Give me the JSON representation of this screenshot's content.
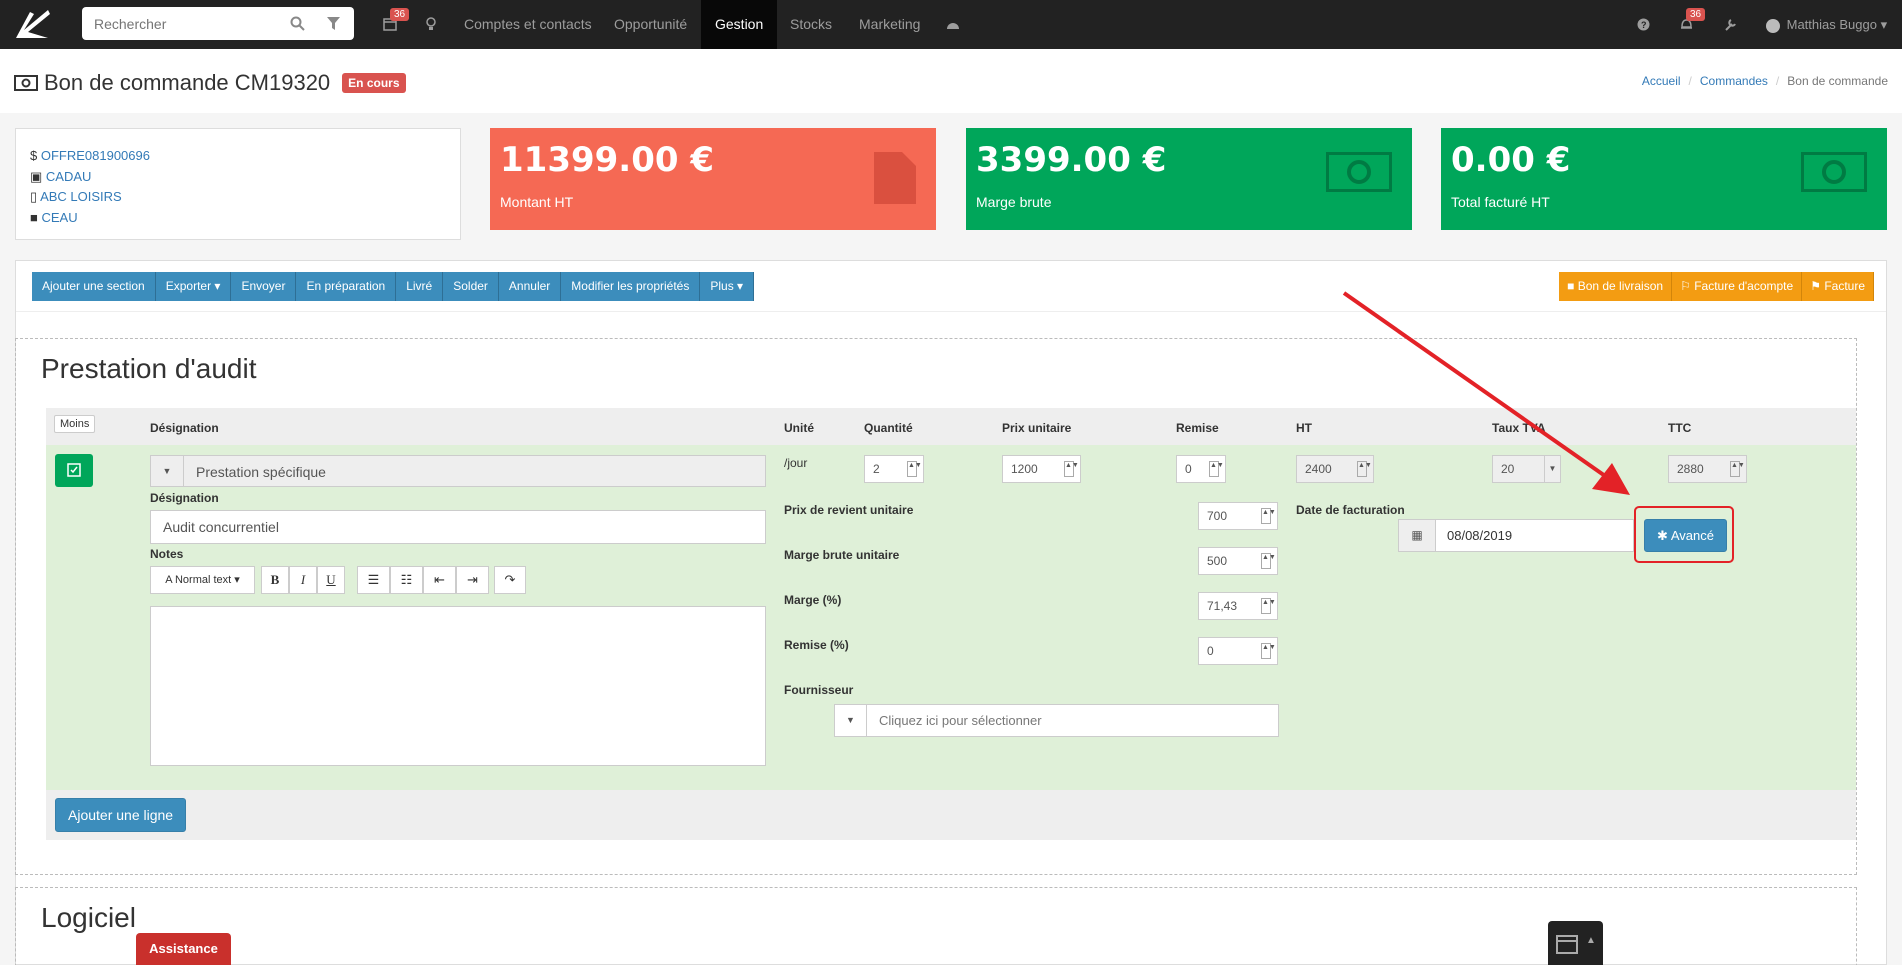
{
  "nav": {
    "search_placeholder": "Rechercher",
    "calendar_badge": "36",
    "notif_badge": "36",
    "links": [
      "Comptes et contacts",
      "Opportunité",
      "Gestion",
      "Stocks",
      "Marketing"
    ],
    "user": "Matthias Buggo"
  },
  "header": {
    "title": "Bon de commande CM19320",
    "status": "En cours",
    "breadcrumb": [
      "Accueil",
      "Commandes",
      "Bon de commande"
    ]
  },
  "info": {
    "offer": "OFFRE081900696",
    "contact": "CADAU",
    "company": "ABC LOISIRS",
    "project": "CEAU"
  },
  "stats": [
    {
      "value": "11399.00 €",
      "label": "Montant HT",
      "color": "#f56954"
    },
    {
      "value": "3399.00 €",
      "label": "Marge brute",
      "color": "#00a65a"
    },
    {
      "value": "0.00 €",
      "label": "Total facturé HT",
      "color": "#00a65a"
    }
  ],
  "toolbar": {
    "left": [
      "Ajouter une section",
      "Exporter",
      "Envoyer",
      "En préparation",
      "Livré",
      "Solder",
      "Annuler",
      "Modifier les propriétés",
      "Plus"
    ],
    "right": [
      "Bon de livraison",
      "Facture d'acompte",
      "Facture"
    ]
  },
  "section1": {
    "title": "Prestation d'audit",
    "less_button": "Moins",
    "columns": [
      "Désignation",
      "Unité",
      "Quantité",
      "Prix unitaire",
      "Remise",
      "HT",
      "Taux TVA",
      "TTC"
    ],
    "row": {
      "product": "Prestation spécifique",
      "unit": "/jour",
      "quantity": "2",
      "unit_price": "1200",
      "discount": "0",
      "ht": "2400",
      "vat": "20",
      "ttc": "2880",
      "designation_label": "Désignation",
      "designation": "Audit concurrentiel",
      "notes_label": "Notes",
      "text_style": "Normal text",
      "cost_label": "Prix de revient unitaire",
      "cost": "700",
      "margin_unit_label": "Marge brute unitaire",
      "margin_unit": "500",
      "margin_pct_label": "Marge (%)",
      "margin_pct": "71,43",
      "discount_pct_label": "Remise (%)",
      "discount_pct": "0",
      "supplier_label": "Fournisseur",
      "supplier_placeholder": "Cliquez ici pour sélectionner",
      "billing_date_label": "Date de facturation",
      "billing_date": "08/08/2019",
      "advanced_button": "Avancé"
    },
    "add_line": "Ajouter une ligne"
  },
  "section2": {
    "title": "Logiciel"
  },
  "assistance": "Assistance"
}
